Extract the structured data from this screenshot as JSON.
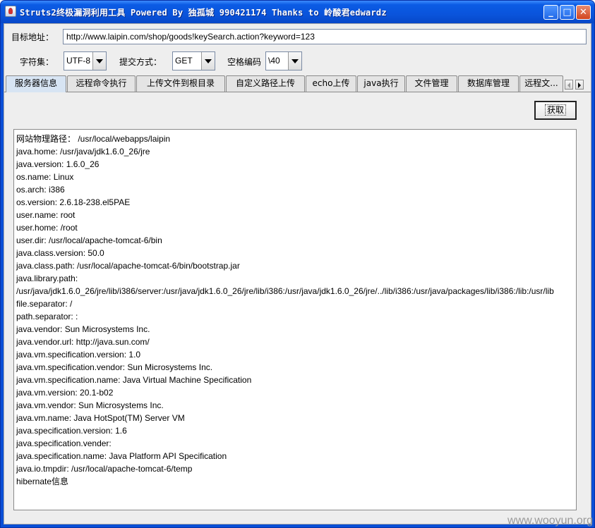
{
  "window": {
    "title": "Struts2终极漏洞利用工具   Powered By 独孤城 990421174 Thanks to 岭酸君edwardz",
    "minimize": "_",
    "maximize": "□",
    "close": "✕"
  },
  "form": {
    "target_label": "目标地址：",
    "target_url": "http://www.laipin.com/shop/goods!keySearch.action?keyword=123",
    "charset_label": "字符集：",
    "charset_value": "UTF-8",
    "method_label": "提交方式：",
    "method_value": "GET",
    "space_label": "空格编码",
    "space_value": "\\40"
  },
  "tabs": [
    {
      "label": "服务器信息"
    },
    {
      "label": "远程命令执行"
    },
    {
      "label": "上传文件到根目录"
    },
    {
      "label": "自定义路径上传"
    },
    {
      "label": "echo上传"
    },
    {
      "label": "java执行"
    },
    {
      "label": "文件管理"
    },
    {
      "label": "数据库管理"
    },
    {
      "label": "远程文..."
    }
  ],
  "panel": {
    "fetch_button": "获取",
    "output_lines": [
      "网站物理路径： /usr/local/webapps/laipin",
      "java.home: /usr/java/jdk1.6.0_26/jre",
      "java.version: 1.6.0_26",
      "os.name: Linux",
      "os.arch: i386",
      "os.version: 2.6.18-238.el5PAE",
      "user.name: root",
      "user.home: /root",
      "user.dir: /usr/local/apache-tomcat-6/bin",
      "java.class.version: 50.0",
      "java.class.path: /usr/local/apache-tomcat-6/bin/bootstrap.jar",
      "java.library.path: /usr/java/jdk1.6.0_26/jre/lib/i386/server:/usr/java/jdk1.6.0_26/jre/lib/i386:/usr/java/jdk1.6.0_26/jre/../lib/i386:/usr/java/packages/lib/i386:/lib:/usr/lib",
      "file.separator: /",
      "path.separator: :",
      "java.vendor: Sun Microsystems Inc.",
      "java.vendor.url: http://java.sun.com/",
      "java.vm.specification.version: 1.0",
      "java.vm.specification.vendor: Sun Microsystems Inc.",
      "java.vm.specification.name: Java Virtual Machine Specification",
      "java.vm.version: 20.1-b02",
      "java.vm.vendor: Sun Microsystems Inc.",
      "java.vm.name: Java HotSpot(TM) Server VM",
      "java.specification.version: 1.6",
      "java.specification.vender:",
      "java.specification.name: Java Platform API Specification",
      "java.io.tmpdir: /usr/local/apache-tomcat-6/temp",
      "hibernate信息"
    ]
  },
  "watermark": "www.wooyun.org",
  "colors": {
    "titlebar": "#0a54dc",
    "client_bg": "#eeeeee",
    "active_tab": "#d7e4f3"
  }
}
